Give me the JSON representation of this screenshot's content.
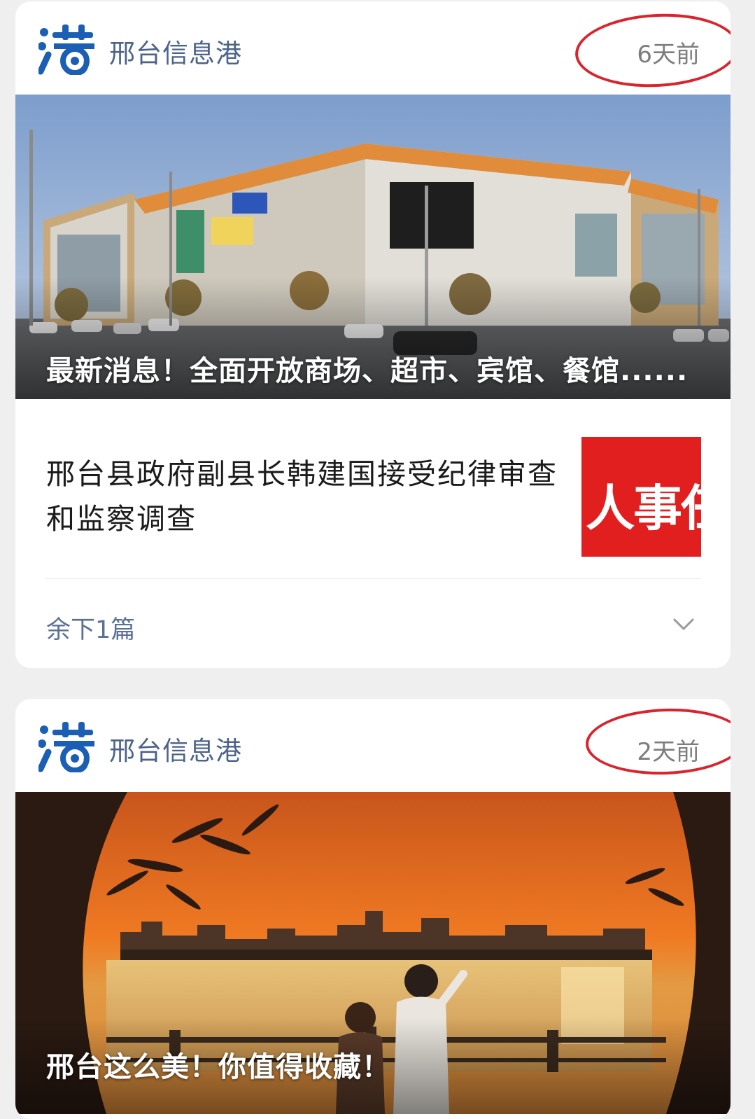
{
  "colors": {
    "accent_blue": "#4c6389",
    "highlight_red": "#d9232d",
    "thumb_red": "#e11f1f",
    "logo_blue": "#1a5fb4"
  },
  "cards": [
    {
      "source": {
        "name": "邢台信息港",
        "logo_icon": "gang-logo-icon"
      },
      "time_ago": "6天前",
      "hero": {
        "title": "最新消息！全面开放商场、超市、宾馆、餐馆......",
        "image": "shopping-mall-photo"
      },
      "article": {
        "title": "邢台县政府副县长韩建国接受纪律审查和监察调查",
        "thumb_text": "人事任"
      },
      "more": {
        "label": "余下1篇",
        "icon": "chevron-down-icon"
      }
    },
    {
      "source": {
        "name": "邢台信息港",
        "logo_icon": "gang-logo-icon"
      },
      "time_ago": "2天前",
      "hero": {
        "title": "邢台这么美！你值得收藏！",
        "image": "sunset-lake-photo"
      }
    }
  ]
}
